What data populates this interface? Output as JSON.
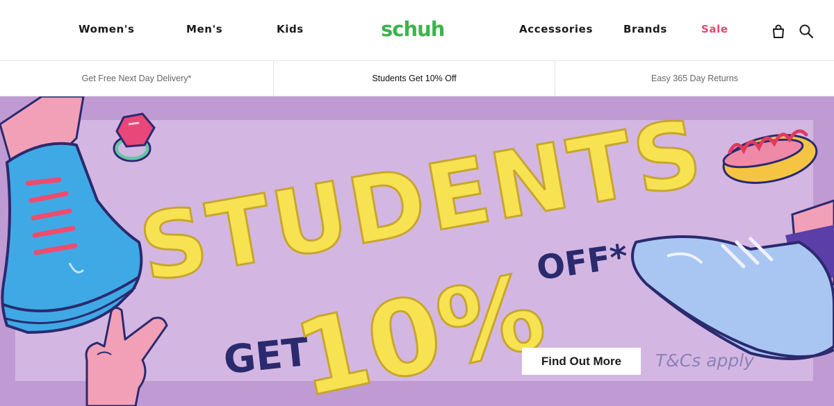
{
  "header": {
    "logo": "schuh",
    "nav_left": [
      {
        "label": "Women's"
      },
      {
        "label": "Men's"
      },
      {
        "label": "Kids"
      }
    ],
    "nav_right": [
      {
        "label": "Accessories"
      },
      {
        "label": "Brands"
      },
      {
        "label": "Sale"
      }
    ],
    "icons": [
      "bag-icon",
      "search-icon"
    ]
  },
  "usp": [
    {
      "label": "Get Free Next Day Delivery*"
    },
    {
      "label": "Students Get 10% Off"
    },
    {
      "label": "Easy 365 Day Returns"
    }
  ],
  "hero": {
    "headline": "STUDENTS",
    "get_text": "GET",
    "percent_text": "10%",
    "off_text": "OFF*",
    "cta_label": "Find Out More",
    "tcs_label": "T&Cs apply"
  },
  "colors": {
    "brand_green": "#3cb44b",
    "sale_pink": "#e8456c",
    "hero_bg": "#c09ad2",
    "hero_panel": "#d3b7e2",
    "headline_yellow": "#f7e251",
    "headline_navy": "#2b2a6e"
  }
}
